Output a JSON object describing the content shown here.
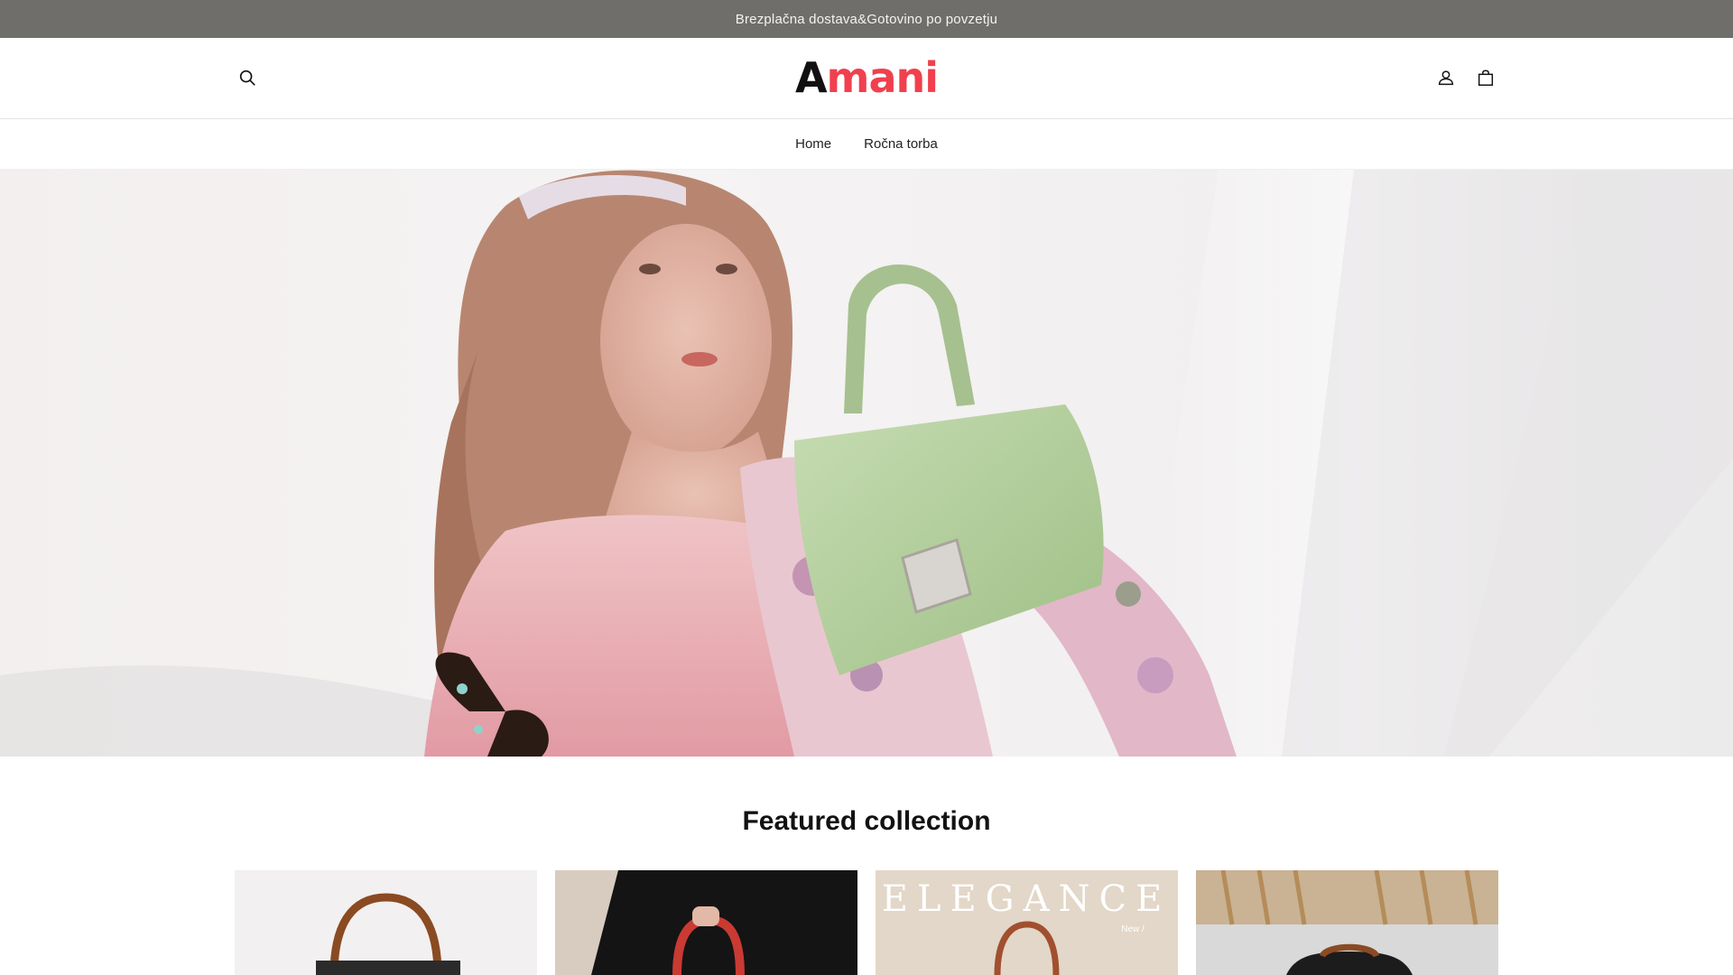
{
  "announcement": {
    "text": "Brezplačna dostava&Gotovino po povzetju"
  },
  "header": {
    "logo": {
      "first_letter": "A",
      "rest": "mani"
    },
    "icons": {
      "search": "search-icon",
      "account": "account-icon",
      "cart": "shopping-bag-icon"
    }
  },
  "nav": {
    "items": [
      {
        "label": "Home"
      },
      {
        "label": "Ročna torba"
      }
    ]
  },
  "hero": {
    "image": "hero-banner-woman-with-green-handbag"
  },
  "featured": {
    "title": "Featured collection",
    "products": [
      {
        "image": "brown-leather-handbag"
      },
      {
        "image": "red-handbag-held"
      },
      {
        "image": "elegance-brown-handbag",
        "overlay_text": "ELEGANCE",
        "overlay_small": "New /"
      },
      {
        "image": "black-brown-doctor-bag"
      }
    ]
  },
  "colors": {
    "announcement_bg": "#6f6e6a",
    "logo_accent": "#f0404e"
  }
}
